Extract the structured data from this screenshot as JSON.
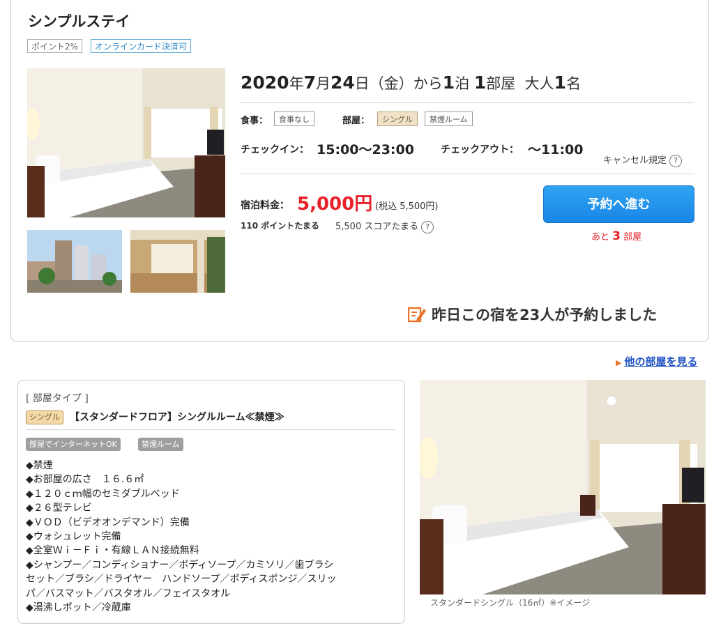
{
  "hotel": {
    "name": "シンプルステイ",
    "tags": [
      "ポイント2%",
      "オンラインカード決済可"
    ]
  },
  "booking": {
    "year": "2020",
    "month": "7",
    "day": "24",
    "weekday": "（金）から",
    "nights": "1",
    "rooms": "1",
    "adults": "1",
    "unit_year": "年",
    "unit_month": "月",
    "unit_day": "日",
    "unit_night": "泊",
    "unit_room": "部屋",
    "adult_label": "大人",
    "unit_person": "名"
  },
  "meal": {
    "label": "食事：",
    "value": "食事なし"
  },
  "room": {
    "label": "部屋：",
    "type": "シングル",
    "smoking": "禁煙ルーム"
  },
  "checkin": {
    "label": "チェックイン：",
    "value": "15:00〜23:00"
  },
  "checkout": {
    "label": "チェックアウト：",
    "value": "〜11:00"
  },
  "cancel_policy": "キャンセル規定",
  "price": {
    "label": "宿泊料金：",
    "value": "5,000円",
    "tax_included": "(税込 5,500円)",
    "points": "110 ポイントたまる",
    "score": "5,500 スコアたまる"
  },
  "reserve_button": "予約へ進む",
  "rooms_left": {
    "prefix": "あと",
    "count": "3",
    "suffix": "部屋"
  },
  "booked_yesterday": "昨日この宿を23人が予約しました",
  "other_rooms_link": "他の部屋を見る",
  "room_type": {
    "heading": "[ 部屋タイプ ]",
    "tag": "シングル",
    "name": "【スタンダードフロア】シングルルーム≪禁煙≫",
    "chips": [
      "部屋でインターネットOK",
      "禁煙ルーム"
    ],
    "description": [
      "◆禁煙",
      "◆お部屋の広さ　１６.６㎡",
      "◆１２０ｃｍ幅のセミダブルベッド",
      "◆２６型テレビ",
      "◆ＶＯＤ（ビデオオンデマンド）完備",
      "◆ウォシュレット完備",
      "◆全室Ｗｉ－Ｆｉ・有線ＬＡＮ接続無料",
      "◆シャンプー／コンディショナー／ボディソープ／カミソリ／歯ブラシ",
      "セット／ブラシ／ドライヤー　ハンドソープ／ボディスポンジ／スリッ",
      "パ／バスマット／バスタオル／フェイスタオル",
      "◆湯沸しポット／冷蔵庫"
    ],
    "photo_caption": "スタンダードシングル（16㎡）※イメージ"
  },
  "colors": {
    "accent_red": "#e8202a",
    "button_blue": "#1a86e6",
    "link_blue": "#1a4fc4"
  },
  "icons": [
    "help-icon",
    "reservation-pencil-icon",
    "triangle-right-icon"
  ]
}
